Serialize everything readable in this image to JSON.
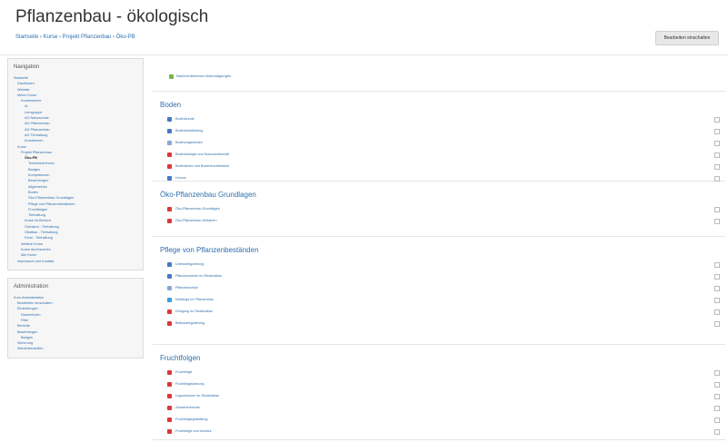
{
  "header": {
    "title": "Pflanzenbau - ökologisch",
    "breadcrumb": "Startseite › Kurse › Projekt Pflanzenbau › Öko-PB",
    "edit_button": "Bearbeiten einschalten"
  },
  "sidebar": {
    "navigation": {
      "title": "Navigation",
      "items": [
        "Startseite",
        "Dashboard",
        "Website",
        "Meine Kurse",
        "Kursbereiche",
        "AI",
        "Lerngruppe",
        "AG Naturschutz",
        "AG Pflanzenbau",
        "AG Pflanzenbau",
        "AG Tierhaltung",
        "Kursthemen",
        "Kurse",
        "Projekt Pflanzenbau",
        "Öko-PB",
        "Teilnehmer/innen",
        "Badges",
        "Kompetenzen",
        "Bewertungen",
        "Allgemeines",
        "Boden",
        "Öko-Pflanzenbau Grundlagen",
        "Pflege von Pflanzenbeständen",
        "Fruchtfolgen",
        "Tierhaltung",
        "Kurse im Bereich",
        "Grünland - Tierhaltung",
        "Obstbau - Tierhaltung",
        "Forst - Tierhaltung",
        "Weitere Kurse",
        "Kurse durchsuchen",
        "Alle Kurse",
        "Impressum und Kontakt"
      ]
    },
    "administration": {
      "title": "Administration",
      "items": [
        "Kurs-Administration",
        "Bearbeiten einschalten",
        "Einstellungen",
        "Nutzer/innen",
        "Filter",
        "Berichte",
        "Bewertungen",
        "Badges",
        "Sicherung",
        "Wiederherstellen"
      ]
    }
  },
  "main": {
    "notice": "Nachrichtenforum Ankündigungen",
    "sections": [
      {
        "name": "Boden",
        "activities": [
          {
            "icon": "doc",
            "label": "Bodenkunde"
          },
          {
            "icon": "doc",
            "label": "Bodenbearbeitung"
          },
          {
            "icon": "img",
            "label": "Bodenorganismen"
          },
          {
            "icon": "pdf",
            "label": "Bodenbiologie und Humuswirtschaft"
          },
          {
            "icon": "pdf",
            "label": "Bodenleben und Bodenfruchtbarkeit"
          },
          {
            "icon": "doc",
            "label": "Humus"
          }
        ]
      },
      {
        "name": "Öko-Pflanzenbau Grundlagen",
        "activities": [
          {
            "icon": "pdf",
            "label": "Öko-Pflanzenbau Grundlagen"
          },
          {
            "icon": "pdf",
            "label": "Öko-Pflanzenbau Verfahren"
          }
        ]
      },
      {
        "name": "Pflege von Pflanzenbeständen",
        "activities": [
          {
            "icon": "doc",
            "label": "Unkrautregulierung"
          },
          {
            "icon": "doc",
            "label": "Pflanzenschutz im Ökolandbau"
          },
          {
            "icon": "img",
            "label": "Pflanzenschutz"
          },
          {
            "icon": "url",
            "label": "Nützlinge im Pflanzenbau"
          },
          {
            "icon": "pdf",
            "label": "Düngung im Ökolandbau"
          },
          {
            "icon": "pdf",
            "label": "Beikrautregulierung"
          }
        ]
      },
      {
        "name": "Fruchtfolgen",
        "activities": [
          {
            "icon": "pdf",
            "label": "Fruchtfolge"
          },
          {
            "icon": "pdf",
            "label": "Fruchtfolgeplanung"
          },
          {
            "icon": "pdf",
            "label": "Leguminosen im Ökolandbau"
          },
          {
            "icon": "pdf",
            "label": "Zwischenfrüchte"
          },
          {
            "icon": "pdf",
            "label": "Fruchtfolgegestaltung"
          },
          {
            "icon": "pdf",
            "label": "Fruchtfolge und Unkraut"
          }
        ]
      }
    ]
  }
}
